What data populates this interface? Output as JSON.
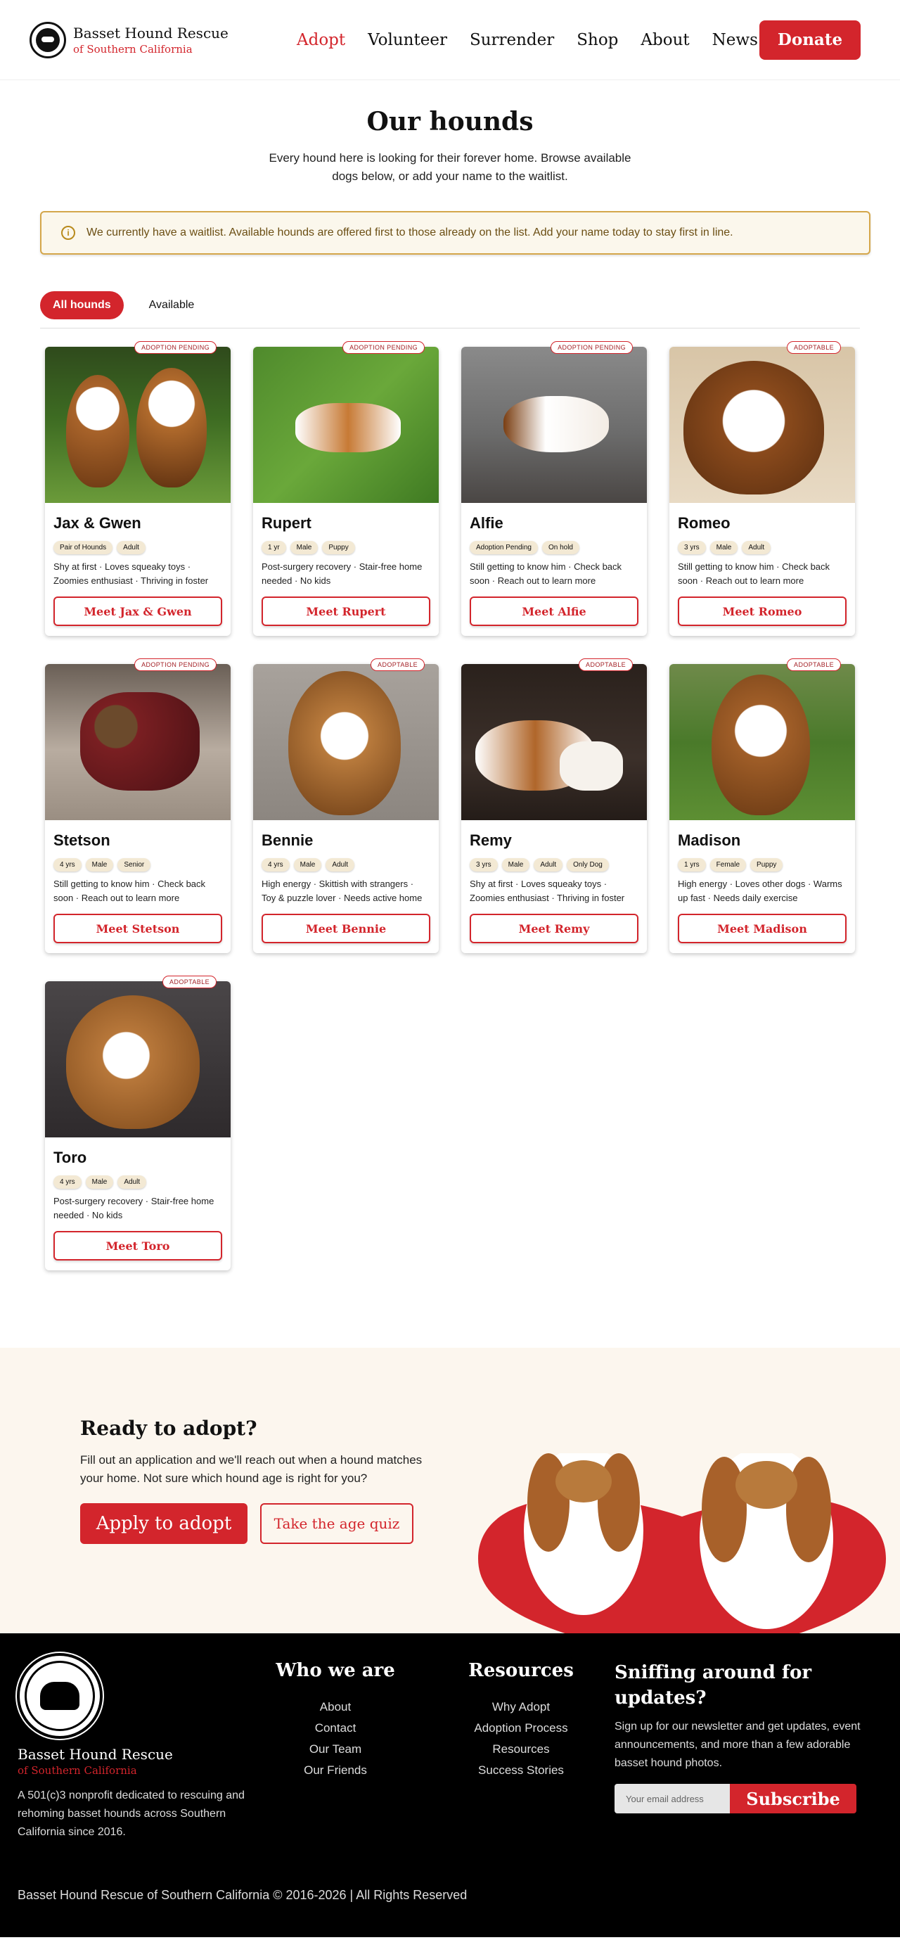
{
  "brand": {
    "name": "Basset Hound Rescue",
    "subtitle": "of Southern California",
    "red": "#d3252c"
  },
  "nav": [
    {
      "label": "Adopt",
      "active": true
    },
    {
      "label": "Volunteer"
    },
    {
      "label": "Surrender"
    },
    {
      "label": "Shop"
    },
    {
      "label": "About"
    },
    {
      "label": "News"
    }
  ],
  "header": {
    "donate_label": "Donate"
  },
  "intro": {
    "title": "Our hounds",
    "text": "Every hound here is looking for their forever home. Browse available dogs below, or add your name to the waitlist."
  },
  "notice": {
    "icon": "info-icon",
    "text": "We currently have a waitlist. Available hounds are offered first to those already on the list. Add your name today to stay first in line."
  },
  "filters": [
    {
      "label": "All hounds",
      "active": true
    },
    {
      "label": "Available"
    }
  ],
  "dogs": [
    {
      "name": "Jax & Gwen",
      "badge": "ADOPTION PENDING",
      "tags": [
        "Pair of Hounds",
        "Adult"
      ],
      "desc": "Shy at first · Loves squeaky toys · Zoomies enthusiast · Thriving in foster",
      "button": "Meet Jax & Gwen"
    },
    {
      "name": "Rupert",
      "badge": "ADOPTION PENDING",
      "tags": [
        "1 yr",
        "Male",
        "Puppy"
      ],
      "desc": "Post-surgery recovery · Stair-free home needed · No kids",
      "button": "Meet Rupert"
    },
    {
      "name": "Alfie",
      "badge": "ADOPTION PENDING",
      "tags": [
        "Adoption Pending",
        "On hold"
      ],
      "desc": "Still getting to know him · Check back soon · Reach out to learn more",
      "button": "Meet Alfie"
    },
    {
      "name": "Romeo",
      "badge": "ADOPTABLE",
      "tags": [
        "3 yrs",
        "Male",
        "Adult"
      ],
      "desc": "Still getting to know him · Check back soon · Reach out to learn more",
      "button": "Meet Romeo"
    },
    {
      "name": "Stetson",
      "badge": "ADOPTION PENDING",
      "tags": [
        "4 yrs",
        "Male",
        "Senior"
      ],
      "desc": "Still getting to know him · Check back soon · Reach out to learn more",
      "button": "Meet Stetson"
    },
    {
      "name": "Bennie",
      "badge": "ADOPTABLE",
      "tags": [
        "4 yrs",
        "Male",
        "Adult"
      ],
      "desc": "High energy · Skittish with strangers · Toy & puzzle lover · Needs active home",
      "button": "Meet Bennie"
    },
    {
      "name": "Remy",
      "badge": "ADOPTABLE",
      "tags": [
        "3 yrs",
        "Male",
        "Adult",
        "Only Dog"
      ],
      "desc": "Shy at first · Loves squeaky toys · Zoomies enthusiast · Thriving in foster",
      "button": "Meet Remy"
    },
    {
      "name": "Madison",
      "badge": "ADOPTABLE",
      "tags": [
        "1 yrs",
        "Female",
        "Puppy"
      ],
      "desc": "High energy · Loves other dogs · Warms up fast · Needs daily exercise",
      "button": "Meet Madison"
    },
    {
      "name": "Toro",
      "badge": "ADOPTABLE",
      "tags": [
        "4 yrs",
        "Male",
        "Adult"
      ],
      "desc": "Post-surgery recovery · Stair-free home needed · No kids",
      "button": "Meet Toro"
    }
  ],
  "cta": {
    "title": "Ready to adopt?",
    "text": "Fill out an application and we'll reach out when a hound matches your home. Not sure which hound age is right for you?",
    "primary": "Apply to adopt",
    "secondary": "Take the age quiz"
  },
  "footer": {
    "seal_text": "BASSET HOUND RESCUE OF SOUTHERN CALIFORNIA",
    "about": "A 501(c)3 nonprofit dedicated to rescuing and rehoming basset hounds across Southern California since 2016.",
    "col1": {
      "title": "Who we are",
      "links": [
        "About",
        "Contact",
        "Our Team",
        "Our Friends"
      ]
    },
    "col2": {
      "title": "Resources",
      "links": [
        "Why Adopt",
        "Adoption Process",
        "Resources",
        "Success Stories"
      ]
    },
    "newsletter": {
      "title": "Sniffing around for updates?",
      "text": "Sign up for our newsletter and get updates, event announcements, and more than a few adorable basset hound photos.",
      "placeholder": "Your email address",
      "button": "Subscribe"
    },
    "copyright": "Basset Hound Rescue of Southern California © 2016-2026 | All Rights Reserved"
  }
}
